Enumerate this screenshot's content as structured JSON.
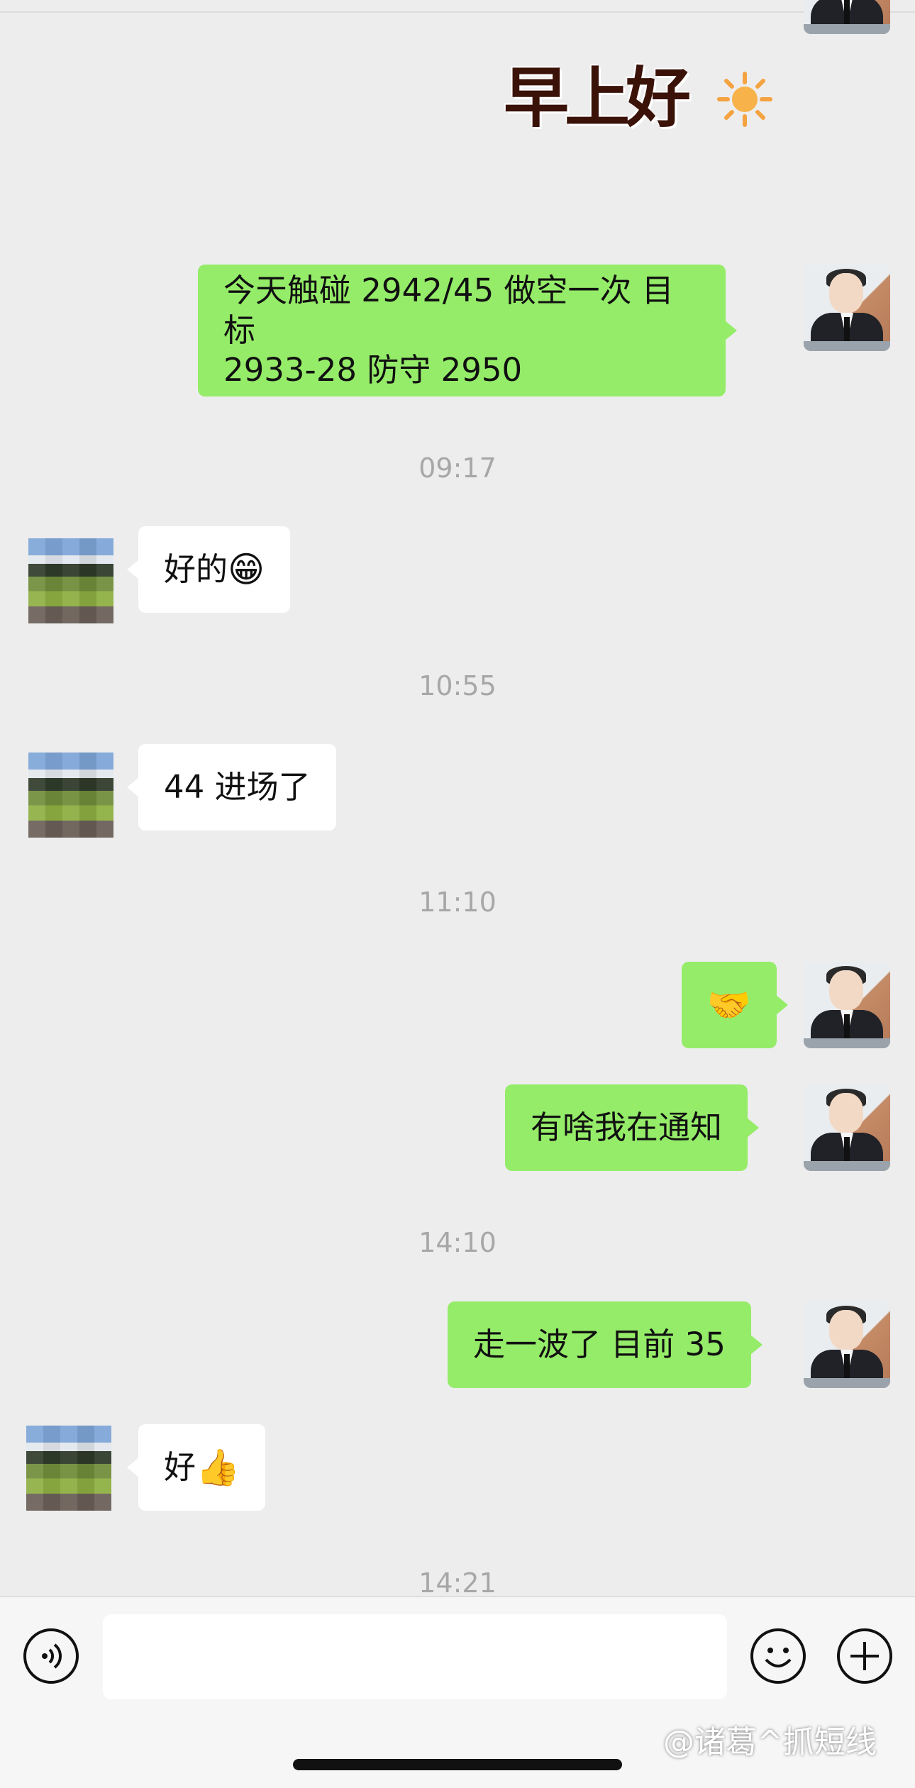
{
  "sticker": {
    "text": "早上好",
    "icon": "sun-icon"
  },
  "messages": {
    "m1": {
      "text_line1": "今天触碰 2942/45 做空一次 目标",
      "text_line2": "2933-28  防守 2950"
    },
    "m2": {
      "text": "好的",
      "emoji": "😁"
    },
    "m3": {
      "text": "44 进场了"
    },
    "m4": {
      "emoji": "🤝"
    },
    "m5": {
      "text": "有啥我在通知"
    },
    "m6": {
      "text": "走一波了 目前 35"
    },
    "m7": {
      "text": "好",
      "emoji": "👍"
    }
  },
  "timestamps": [
    "09:17",
    "10:55",
    "11:10",
    "14:10",
    "14:21"
  ],
  "input": {
    "placeholder": "",
    "voice_icon": "voice-icon",
    "emoji_icon": "smiley-icon",
    "plus_icon": "plus-icon"
  },
  "watermark": "@诸葛^抓短线",
  "colors": {
    "background": "#ededed",
    "outgoing_bubble": "#95ec69",
    "incoming_bubble": "#ffffff",
    "timestamp": "#a7a7a7"
  }
}
